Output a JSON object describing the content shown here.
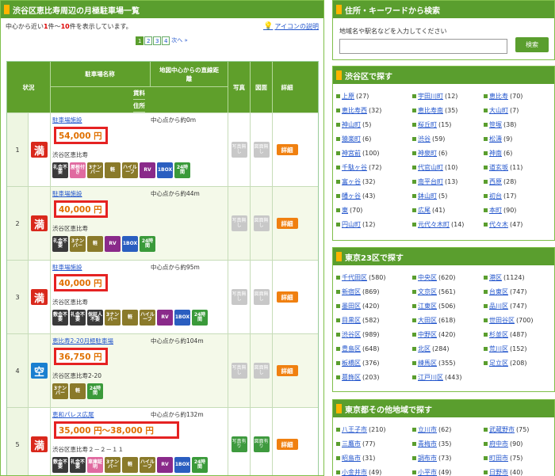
{
  "left": {
    "title": "渋谷区恵比寿周辺の月極駐車場一覧",
    "info": {
      "prefix": "中心から近い",
      "from": "1",
      "mid": "件～",
      "to": "10",
      "suffix": "件を表示しています。"
    },
    "help_link": "アイコンの説明",
    "pager": {
      "pages": [
        "1",
        "2",
        "3",
        "4"
      ],
      "next": "次へ »"
    },
    "headers": {
      "status": "状況",
      "name": "駐車場名称",
      "distance": "地図中心からの直線距離",
      "fee": "賃料",
      "address": "住所",
      "photo": "写真",
      "map": "図面",
      "detail": "詳細"
    },
    "rows": [
      {
        "num": "1",
        "status": "満",
        "name": "駐車場施設",
        "distance": "中心点から約0m",
        "price": "54,000 円",
        "address": "渋谷区恵比寿",
        "features": [
          "礼金不要",
          "屋根付き",
          "3ナンバー",
          "軽",
          "ハイルーフ",
          "RV",
          "1BOX",
          "24時間"
        ],
        "photo": "写真無し",
        "map": "図面無し",
        "detail": "詳細"
      },
      {
        "num": "2",
        "status": "満",
        "name": "駐車場施設",
        "distance": "中心点から約44m",
        "price": "40,000 円",
        "address": "渋谷区恵比寿",
        "features": [
          "礼金不要",
          "3ナンバー",
          "軽",
          "RV",
          "1BOX",
          "24時間"
        ],
        "photo": "写真無し",
        "map": "図面無し",
        "detail": "詳細"
      },
      {
        "num": "3",
        "status": "満",
        "name": "駐車場施設",
        "distance": "中心点から約95m",
        "price": "40,000 円",
        "address": "渋谷区恵比寿",
        "features": [
          "敷金不要",
          "礼金不要",
          "保証人不要",
          "3ナンバー",
          "軽",
          "ハイルーフ",
          "RV",
          "1BOX",
          "24時間"
        ],
        "photo": "写真無し",
        "map": "図面無し",
        "detail": "詳細"
      },
      {
        "num": "4",
        "status": "空",
        "name": "恵比寿2-20月極駐車場",
        "distance": "中心点から約104m",
        "price": "36,750 円",
        "address": "渋谷区恵比寿2-20",
        "features": [
          "3ナンバー",
          "軽",
          "24時間"
        ],
        "photo": "写真無し",
        "map": "図面無し",
        "detail": "詳細"
      },
      {
        "num": "5",
        "status": "満",
        "name": "恵和パレス広尾",
        "distance": "中心点から約132m",
        "price": "35,000 円～38,000 円",
        "address": "渋谷区恵比寿２－２－１１",
        "features": [
          "敷金不要",
          "礼金不要",
          "車庫証明",
          "3ナンバー",
          "軽",
          "ハイルーフ",
          "RV",
          "1BOX",
          "24時間"
        ],
        "photo": "写真有り",
        "map": "図面有り",
        "detail": "詳細"
      }
    ]
  },
  "search": {
    "title": "住所・キーワードから検索",
    "label": "地域名や駅名などを入力してください",
    "placeholder": "",
    "button": "検索"
  },
  "shibuya": {
    "title": "渋谷区で探す",
    "items": [
      [
        "上原",
        "(27)"
      ],
      [
        "宇田川町",
        "(12)"
      ],
      [
        "恵比寿",
        "(70)"
      ],
      [
        "恵比寿西",
        "(32)"
      ],
      [
        "恵比寿南",
        "(35)"
      ],
      [
        "大山町",
        "(7)"
      ],
      [
        "神山町",
        "(5)"
      ],
      [
        "桜丘町",
        "(15)"
      ],
      [
        "笹塚",
        "(38)"
      ],
      [
        "猿楽町",
        "(6)"
      ],
      [
        "渋谷",
        "(59)"
      ],
      [
        "松濤",
        "(9)"
      ],
      [
        "神宮前",
        "(100)"
      ],
      [
        "神泉町",
        "(6)"
      ],
      [
        "神南",
        "(6)"
      ],
      [
        "千駄ヶ谷",
        "(72)"
      ],
      [
        "代官山町",
        "(10)"
      ],
      [
        "道玄坂",
        "(11)"
      ],
      [
        "富ヶ谷",
        "(32)"
      ],
      [
        "南平台町",
        "(13)"
      ],
      [
        "西原",
        "(28)"
      ],
      [
        "幡ヶ谷",
        "(43)"
      ],
      [
        "鉢山町",
        "(5)"
      ],
      [
        "初台",
        "(17)"
      ],
      [
        "東",
        "(70)"
      ],
      [
        "広尾",
        "(41)"
      ],
      [
        "本町",
        "(90)"
      ],
      [
        "円山町",
        "(12)"
      ],
      [
        "元代々木町",
        "(14)"
      ],
      [
        "代々木",
        "(47)"
      ]
    ]
  },
  "tokyo23": {
    "title": "東京23区で探す",
    "items": [
      [
        "千代田区",
        "(580)"
      ],
      [
        "中央区",
        "(620)"
      ],
      [
        "港区",
        "(1124)"
      ],
      [
        "新宿区",
        "(869)"
      ],
      [
        "文京区",
        "(561)"
      ],
      [
        "台東区",
        "(747)"
      ],
      [
        "墨田区",
        "(420)"
      ],
      [
        "江東区",
        "(506)"
      ],
      [
        "品川区",
        "(747)"
      ],
      [
        "目黒区",
        "(582)"
      ],
      [
        "大田区",
        "(618)"
      ],
      [
        "世田谷区",
        "(700)"
      ],
      [
        "渋谷区",
        "(989)"
      ],
      [
        "中野区",
        "(420)"
      ],
      [
        "杉並区",
        "(487)"
      ],
      [
        "豊島区",
        "(648)"
      ],
      [
        "北区",
        "(284)"
      ],
      [
        "荒川区",
        "(152)"
      ],
      [
        "板橋区",
        "(376)"
      ],
      [
        "練馬区",
        "(355)"
      ],
      [
        "足立区",
        "(208)"
      ],
      [
        "葛飾区",
        "(203)"
      ],
      [
        "江戸川区",
        "(443)"
      ]
    ]
  },
  "tokyo_other": {
    "title": "東京都その他地域で探す",
    "items": [
      [
        "八王子市",
        "(210)"
      ],
      [
        "立川市",
        "(62)"
      ],
      [
        "武蔵野市",
        "(75)"
      ],
      [
        "三鷹市",
        "(77)"
      ],
      [
        "青梅市",
        "(35)"
      ],
      [
        "府中市",
        "(90)"
      ],
      [
        "昭島市",
        "(31)"
      ],
      [
        "調布市",
        "(73)"
      ],
      [
        "町田市",
        "(75)"
      ],
      [
        "小金井市",
        "(49)"
      ],
      [
        "小平市",
        "(49)"
      ],
      [
        "日野市",
        "(40)"
      ]
    ]
  },
  "colors": {
    "header_green": "#5a9e2e",
    "price_border": "#e52222",
    "full": "#d9281c",
    "empty": "#1a7fd0",
    "detail_btn": "#f08010"
  }
}
